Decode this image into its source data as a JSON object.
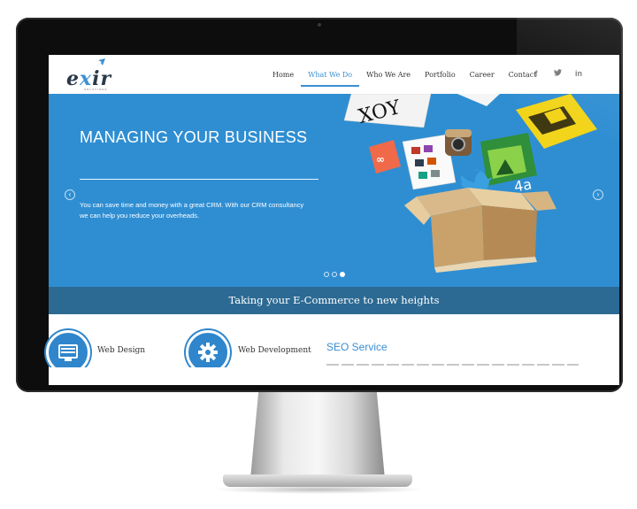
{
  "logo": {
    "text": "exir",
    "subtext": "SOLUTIONS"
  },
  "nav": {
    "items": [
      "Home",
      "What We Do",
      "Who We Are",
      "Portfolio",
      "Career",
      "Contact"
    ],
    "active": "What We Do"
  },
  "social": {
    "facebook": "f",
    "twitter": "t",
    "linkedin": "in"
  },
  "hero": {
    "title": "MANAGING YOUR BUSINESS",
    "text": "You can save time and money with a great CRM. With our CRM consultancy we can help you reduce your overheads.",
    "prev": "‹",
    "next": "›",
    "slide_count": 3,
    "active_slide": 3
  },
  "tagline": "Taking your E-Commerce to new heights",
  "services": {
    "web_design": "Web Design",
    "web_development": "Web Development",
    "seo_title": "SEO Service"
  },
  "colors": {
    "brand_blue": "#2f8ed2",
    "tagline_bar": "#2c6a93",
    "accent": "#3a8fd4"
  },
  "icons": [
    "apple-logo-icon",
    "monitor-icon",
    "gear-icon",
    "arrow-left-icon",
    "arrow-right-icon",
    "facebook-icon",
    "twitter-icon",
    "linkedin-icon",
    "instagram-icon",
    "link-icon"
  ]
}
